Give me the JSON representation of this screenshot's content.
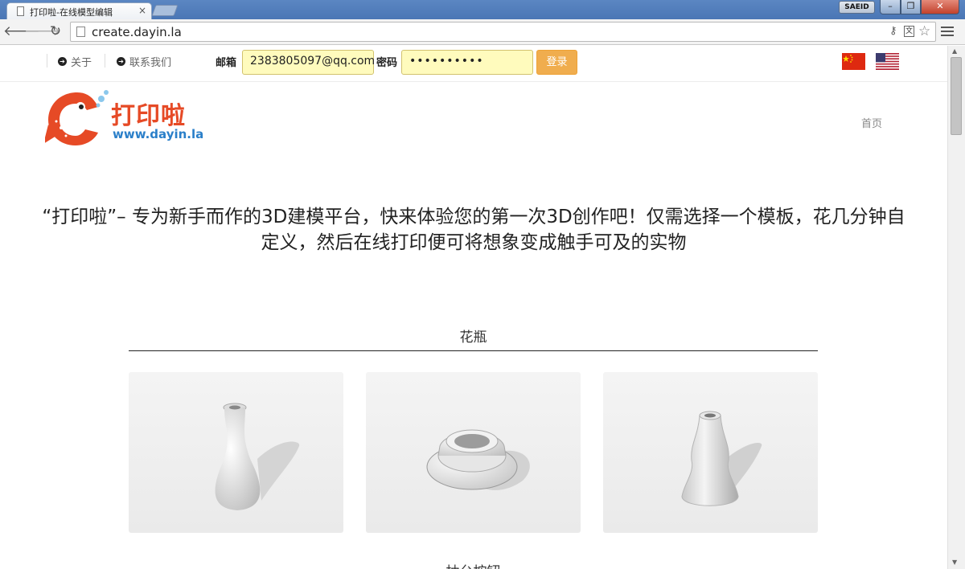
{
  "browser": {
    "tab_title": "打印啦-在线模型编辑",
    "tab_close": "×",
    "url": "create.dayin.la",
    "profile": "SAEID"
  },
  "nav": {
    "about": "关于",
    "contact": "联系我们",
    "email_label": "邮箱",
    "email_value": "2383805097@qq.com",
    "password_label": "密码",
    "password_value": "••••••••••",
    "login_button": "登录",
    "home": "首页"
  },
  "logo": {
    "name": "打印啦",
    "url": "www.dayin.la"
  },
  "slogan": "“打印啦”– 专为新手而作的3D建模平台，快来体验您的第一次3D创作吧！仅需选择一个模板，花几分钟自定义，然后在线打印便可将想象变成触手可及的实物",
  "sections": [
    {
      "title": "花瓶"
    },
    {
      "title": "抽台按钮"
    }
  ],
  "colors": {
    "accent": "#f0ad4e",
    "logo_red": "#e64a26",
    "logo_blue": "#2a7fc9",
    "autofill": "#fffbbd"
  },
  "icons": [
    "back-arrow-icon",
    "forward-arrow-icon",
    "reload-icon",
    "page-icon",
    "key-icon",
    "translate-icon",
    "star-icon",
    "menu-icon",
    "arrow-circle-icon",
    "china-flag-icon",
    "us-flag-icon"
  ]
}
